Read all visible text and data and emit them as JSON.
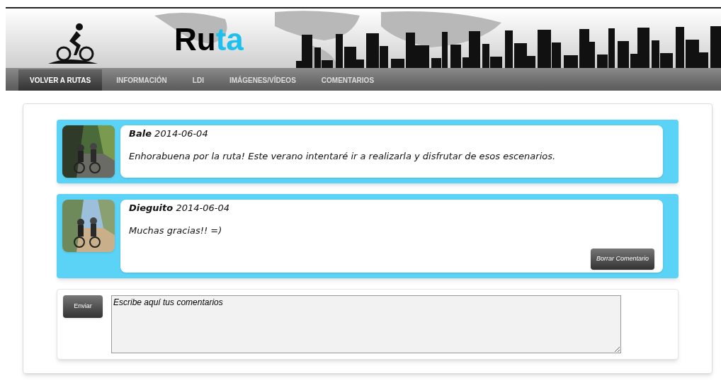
{
  "logo": {
    "text": "Ru",
    "accent": "ta"
  },
  "tabs": [
    {
      "label": "VOLVER A RUTAS",
      "selected": true
    },
    {
      "label": "INFORMACIÓN",
      "selected": false
    },
    {
      "label": "LDI",
      "selected": false
    },
    {
      "label": "IMÁGENES/VÍDEOS",
      "selected": false
    },
    {
      "label": "COMENTARIOS",
      "selected": false
    }
  ],
  "comments": [
    {
      "author": "Bale",
      "date": "2014-06-04",
      "text": "Enhorabuena por la ruta! Este verano intentaré ir a realizarla y disfrutar de esos escenarios."
    },
    {
      "author": "Dieguito",
      "date": "2014-06-04",
      "text": "Muchas gracias!! =)",
      "delete_button": "Borrar Comentario"
    }
  ],
  "compose": {
    "button": "Enviar",
    "value": "Escribe aquí tus comentarios"
  }
}
